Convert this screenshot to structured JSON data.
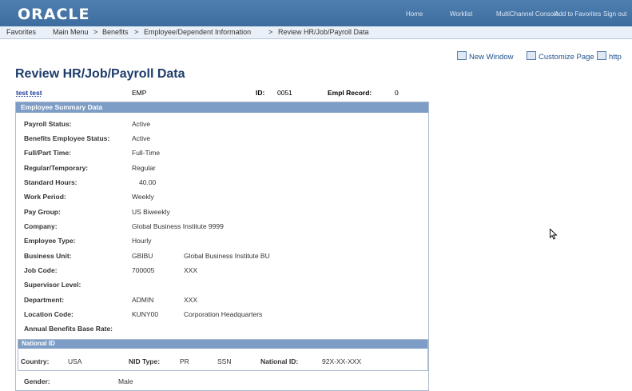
{
  "header": {
    "logo": "ORACLE",
    "links": [
      "Home",
      "Worklist",
      "MultiChannel Console",
      "Add to Favorites",
      "Sign out"
    ]
  },
  "nav": {
    "favorites": "Favorites",
    "main_menu": "Main Menu",
    "separator": ">",
    "crumbs": [
      "Benefits",
      "Employee/Dependent Information",
      "Review HR/Job/Payroll Data"
    ]
  },
  "actions": {
    "new_window": "New Window",
    "customize_page": "Customize Page",
    "http": "http"
  },
  "page": {
    "title": "Review HR/Job/Payroll Data",
    "employee_name": "test test",
    "employee_type_code": "EMP",
    "id_label": "ID:",
    "id_value": "0051",
    "empl_record_label": "Empl Record:",
    "empl_record_value": "0"
  },
  "summary": {
    "header": "Employee Summary Data",
    "payroll_status": {
      "label": "Payroll Status:",
      "value": "Active"
    },
    "benefits_status": {
      "label": "Benefits Employee Status:",
      "value": "Active"
    },
    "full_part": {
      "label": "Full/Part Time:",
      "value": "Full-Time"
    },
    "reg_temp": {
      "label": "Regular/Temporary:",
      "value": "Regular"
    },
    "std_hours": {
      "label": "Standard Hours:",
      "value": "40.00"
    },
    "work_period": {
      "label": "Work Period:",
      "value": "Weekly"
    },
    "pay_group": {
      "label": "Pay Group:",
      "value": "US Biweekly"
    },
    "company": {
      "label": "Company:",
      "value": "Global Business Institute 9999"
    },
    "employee_type": {
      "label": "Employee Type:",
      "value": "Hourly"
    },
    "business_unit": {
      "label": "Business Unit:",
      "value": "GBIBU",
      "desc": "Global Business Institute BU"
    },
    "job_code": {
      "label": "Job Code:",
      "value": "700005",
      "desc": "XXX"
    },
    "supervisor_level": {
      "label": "Supervisor Level:"
    },
    "department": {
      "label": "Department:",
      "value": "ADMIN",
      "desc": "XXX"
    },
    "location_code": {
      "label": "Location Code:",
      "value": "KUNY00",
      "desc": "Corporation Headquarters"
    },
    "annual_benefits": {
      "label": "Annual Benefits Base Rate:"
    }
  },
  "national_id": {
    "header": "National ID",
    "country_label": "Country:",
    "country_value": "USA",
    "nid_type_label": "NID Type:",
    "nid_type_value": "PR",
    "nid_type_desc": "SSN",
    "national_id_label": "National ID:",
    "national_id_value": "92X-XX-XXX"
  },
  "gender": {
    "label": "Gender:",
    "value": "Male"
  },
  "colors": {
    "header_blue": "#3d6d9f",
    "section_header": "#7d9dc6",
    "title": "#1e3c6b"
  }
}
